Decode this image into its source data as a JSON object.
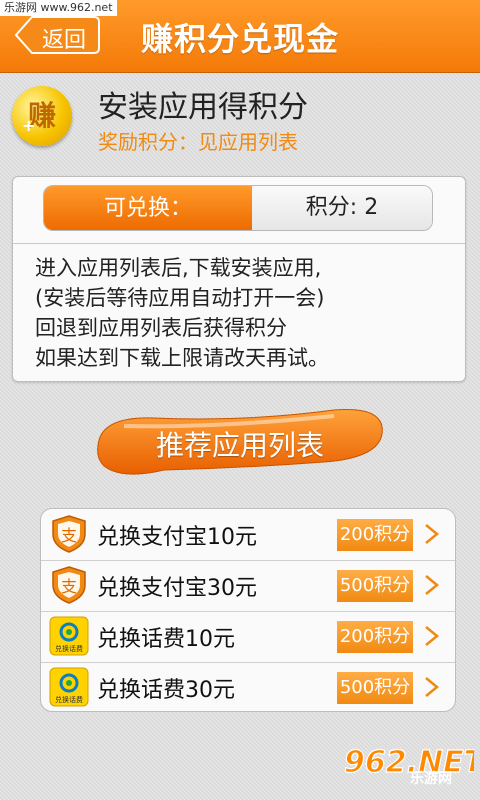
{
  "watermark_top": "乐游网 www.962.net",
  "header": {
    "back_label": "返回",
    "title": "赚积分兑现金"
  },
  "app": {
    "badge_char": "赚",
    "badge_plus": "+",
    "name": "安装应用得积分",
    "reward": "奖励积分：见应用列表"
  },
  "exchange": {
    "left_label": "可兑换：",
    "right_label": "积分: 2"
  },
  "instructions": [
    "进入应用列表后,下载安装应用,",
    "(安装后等待应用自动打开一会)",
    "回退到应用列表后获得积分",
    "如果达到下载上限请改天再试。"
  ],
  "recommend_button": "推荐应用列表",
  "rewards": [
    {
      "label": "兑换支付宝10元",
      "points": "200积分",
      "icon": "alipay-shield-icon"
    },
    {
      "label": "兑换支付宝30元",
      "points": "500积分",
      "icon": "alipay-shield-icon"
    },
    {
      "label": "兑换话费10元",
      "points": "200积分",
      "icon": "china-mobile-icon"
    },
    {
      "label": "兑换话费30元",
      "points": "500积分",
      "icon": "china-mobile-icon"
    }
  ],
  "mobile_icon_caption": "兑换话费",
  "watermark_bottom": {
    "logo": "962.NET",
    "text": "乐游网"
  },
  "colors": {
    "accent": "#f47a08",
    "reward_text": "#f08a12"
  }
}
